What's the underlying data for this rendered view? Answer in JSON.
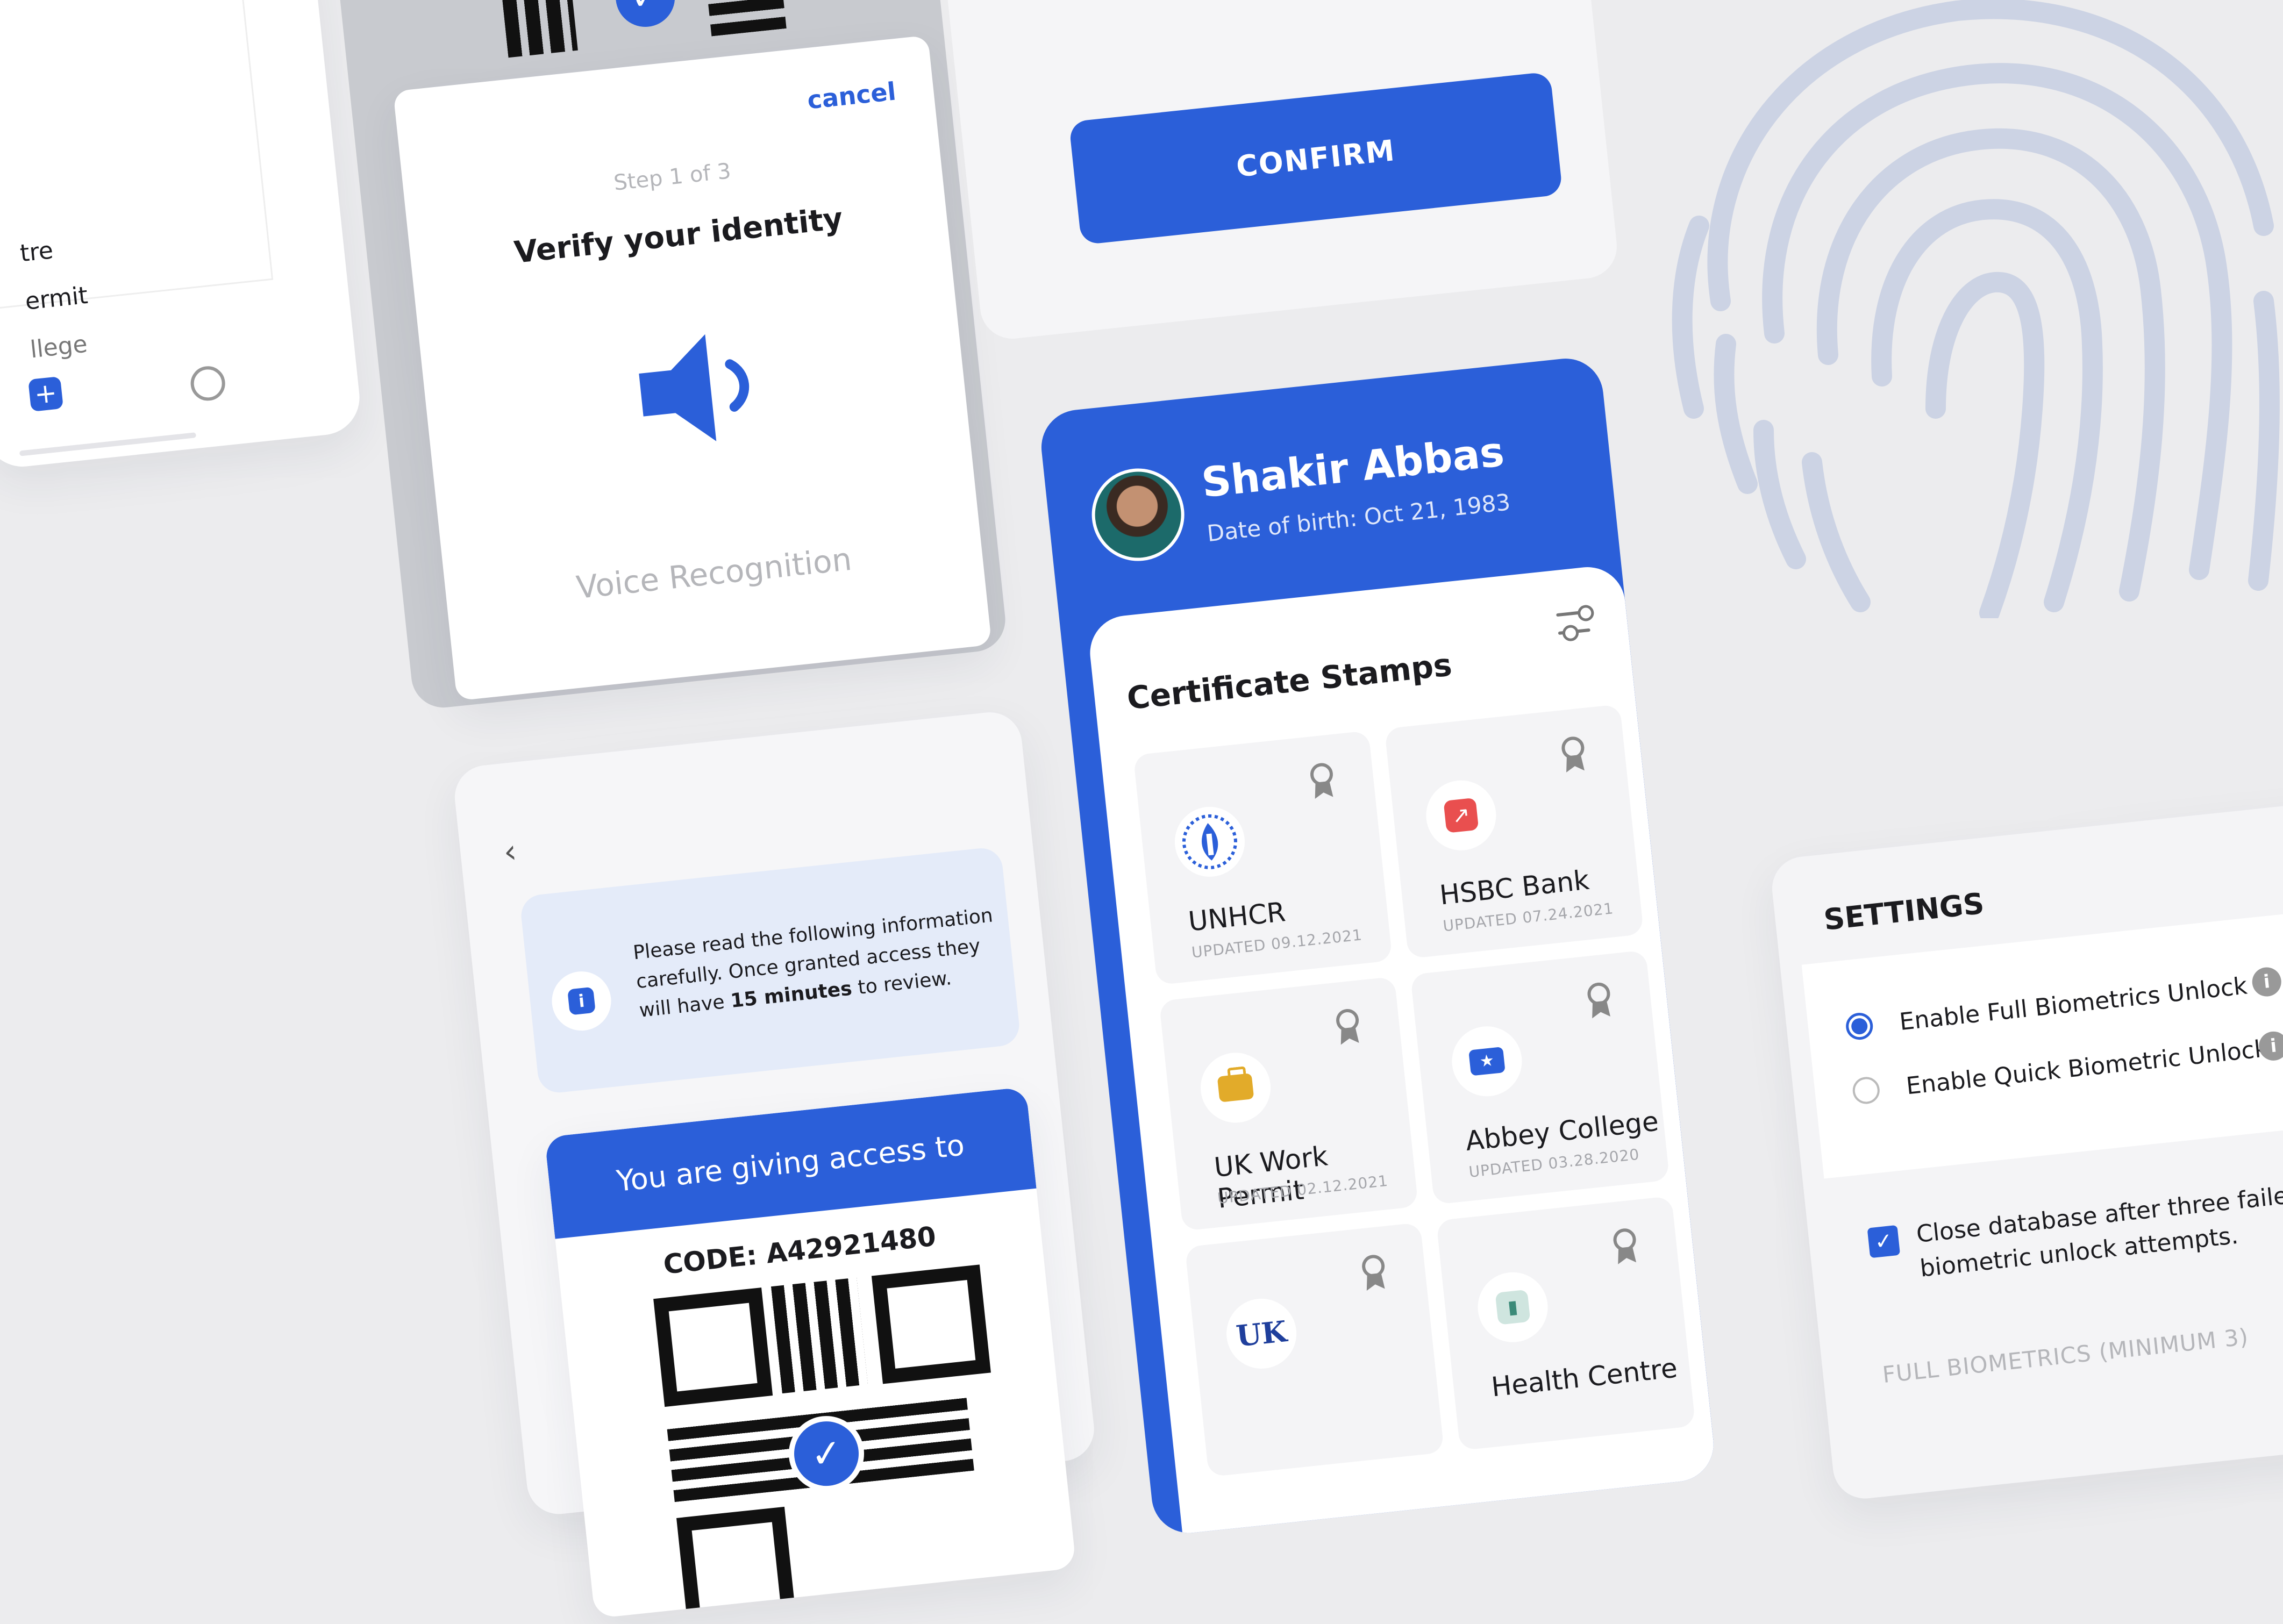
{
  "left_panel": {
    "list_items": [
      "tre",
      "ermit",
      "llege"
    ]
  },
  "verify_modal": {
    "cancel_label": "cancel",
    "step_label": "Step 1 of 3",
    "title": "Verify your identity",
    "method_label": "Voice Recognition",
    "icon": "speaker-icon"
  },
  "confirm_panel": {
    "confirm_label": "CONFIRM"
  },
  "profile": {
    "name": "Shakir Abbas",
    "dob": "Date of birth: Oct 21, 1983",
    "section_title": "Certificate Stamps",
    "stamps": [
      {
        "title": "UNHCR",
        "updated": "UPDATED 09.12.2021",
        "icon": "unhcr-logo-icon"
      },
      {
        "title": "HSBC Bank",
        "updated": "UPDATED 07.24.2021",
        "icon": "chart-icon"
      },
      {
        "title": "UK Work Permit",
        "updated": "UPDATED 02.12.2021",
        "icon": "briefcase-icon"
      },
      {
        "title": "Abbey College",
        "updated": "UPDATED 03.28.2020",
        "icon": "ticket-icon"
      },
      {
        "title": "",
        "updated": "",
        "icon": "uk-logo-icon"
      },
      {
        "title": "Health Centre",
        "updated": "",
        "icon": "bar-chart-icon"
      }
    ]
  },
  "access": {
    "info_text_1": "Please read the following information",
    "info_text_2": "carefully. Once granted access they",
    "info_text_3": "will have",
    "info_bold": "15 minutes",
    "info_text_4": "to review.",
    "banner": "You are giving access to",
    "code": "CODE: A42921480"
  },
  "settings": {
    "title": "SETTINGS",
    "option_full": "Enable Full Biometrics Unlock",
    "option_quick": "Enable Quick Biometric Unlock",
    "checkbox_text_1": "Close database after three failed",
    "checkbox_text_2": "biometric unlock attempts.",
    "footer_label": "FULL BIOMETRICS (MINIMUM 3)"
  },
  "colors": {
    "accent": "#2b5fd9",
    "background": "#ececee",
    "fingerprint": "#ccd3e4"
  }
}
